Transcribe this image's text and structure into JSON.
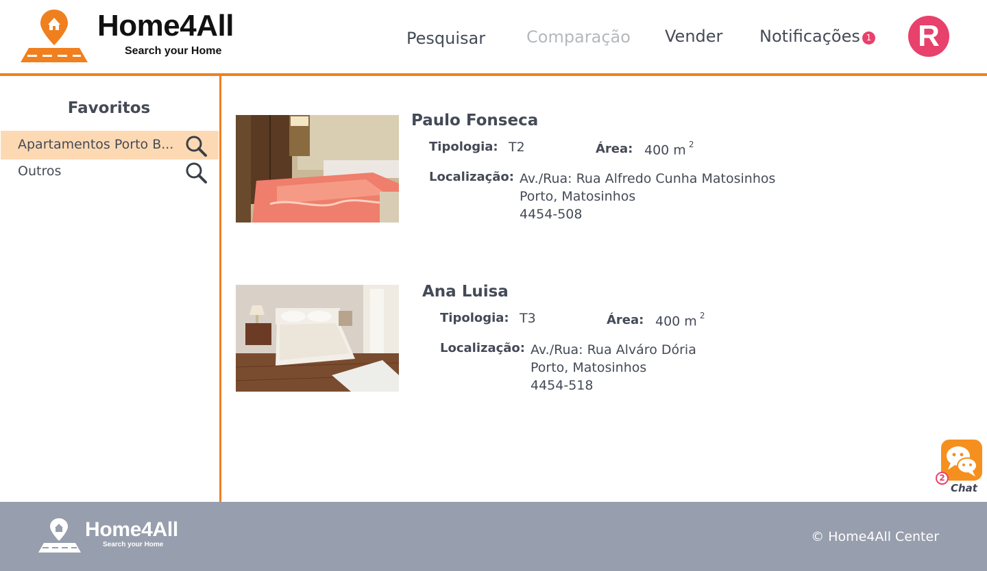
{
  "brand": {
    "name": "Home4All",
    "tagline": "Search your Home",
    "accent": "#f07f1e"
  },
  "nav": {
    "search": "Pesquisar",
    "compare": "Comparação",
    "sell": "Vender",
    "notifications": "Notificações",
    "notification_count": "1",
    "avatar_initial": "R"
  },
  "sidebar": {
    "title": "Favoritos",
    "items": [
      {
        "label": "Apartamentos Porto B...",
        "active": true,
        "icon": "search-icon"
      },
      {
        "label": "Outros",
        "active": false,
        "icon": "search-icon"
      }
    ]
  },
  "listings": [
    {
      "owner": "Paulo Fonseca",
      "tipologia_label": "Tipologia:",
      "tipologia": "T2",
      "area_label": "Área:",
      "area_value": "400 m",
      "area_unit_sup": "2",
      "location_label": "Localização:",
      "address_line1": "Av./Rua: Rua Alfredo Cunha Matosinhos",
      "address_line2": "Porto, Matosinhos",
      "postal_code": "4454-508",
      "photo": "bedroom-photo-coral-bedspread"
    },
    {
      "owner": "Ana Luisa",
      "tipologia_label": "Tipologia:",
      "tipologia": "T3",
      "area_label": "Área:",
      "area_value": "400 m",
      "area_unit_sup": "2",
      "location_label": "Localização:",
      "address_line1": "Av./Rua: Rua Alváro Dória",
      "address_line2": "Porto, Matosinhos",
      "postal_code": "4454-518",
      "photo": "bedroom-photo-white-bedspread"
    }
  ],
  "chat": {
    "label": "Chat",
    "count": "2",
    "icon": "chat-bubbles-icon"
  },
  "footer": {
    "brand": "Home4All",
    "tagline": "Search your Home",
    "copyright": "© Home4All Center"
  }
}
